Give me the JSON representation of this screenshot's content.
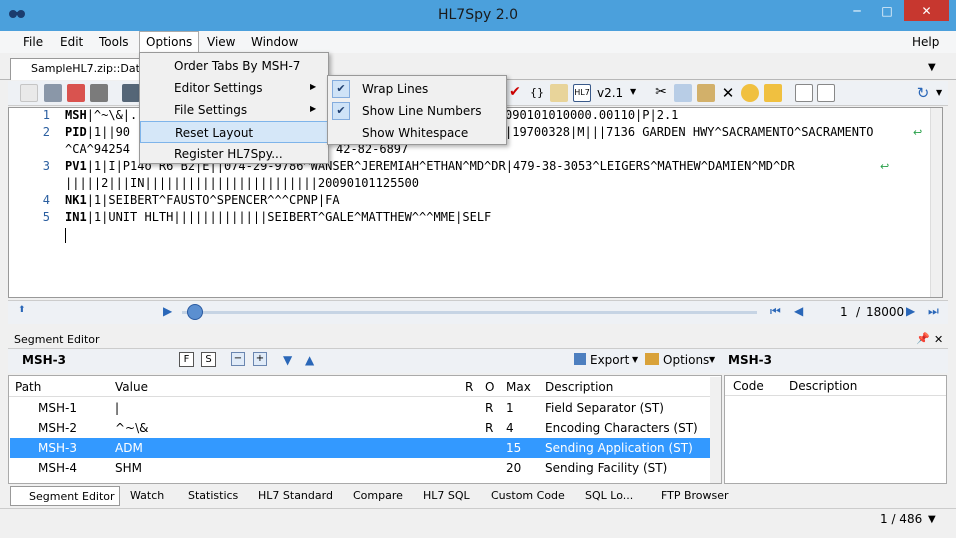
{
  "window": {
    "title": "HL7Spy 2.0",
    "minimize": "─",
    "maximize": "□",
    "close": "✕"
  },
  "menu": {
    "items": [
      "File",
      "Edit",
      "Tools",
      "Options",
      "View",
      "Window"
    ],
    "help": "Help"
  },
  "doc_tab": {
    "label": "SampleHL7.zip::Data."
  },
  "toolbar": {
    "version": "v2.1"
  },
  "options_menu": {
    "items": [
      "Order Tabs By MSH-7",
      "Editor Settings",
      "File Settings",
      "Reset Layout",
      "Register HL7Spy..."
    ]
  },
  "editor_settings_submenu": {
    "items": [
      {
        "label": "Wrap Lines",
        "checked": true
      },
      {
        "label": "Show Line Numbers",
        "checked": true
      },
      {
        "label": "Show Whitespace",
        "checked": false
      }
    ]
  },
  "editor": {
    "lines": [
      {
        "no": "1",
        "seg": "MSH",
        "text": "|^~\\&|.",
        "tail": "090101010000.00110|P|2.1"
      },
      {
        "no": "2",
        "seg": "PID",
        "text": "|1||90",
        "tail": "|19700328|M|||7136 GARDEN HWY^SACRAMENTO^SACRAMENTO"
      },
      {
        "no": "",
        "seg": "",
        "text": "^CA^94254",
        "tail": "42-82-6897"
      },
      {
        "no": "3",
        "seg": "PV1",
        "text": "|1|I|P14o R6 B2|E||074-29-9786^WANSER^JEREMIAH^ETHAN^MD^DR|479-38-3053^LEIGERS^MATHEW^DAMIEN^MD^DR",
        "tail": ""
      },
      {
        "no": "",
        "seg": "",
        "text": "|||||2|||IN||||||||||||||||||||||||20090101125500",
        "tail": ""
      },
      {
        "no": "4",
        "seg": "NK1",
        "text": "|1|SEIBERT^FAUSTO^SPENCER^^^CPNP|FA",
        "tail": ""
      },
      {
        "no": "5",
        "seg": "IN1",
        "text": "|1|UNIT HLTH|||||||||||||SEIBERT^GALE^MATTHEW^^^MME|SELF",
        "tail": ""
      }
    ]
  },
  "navigator": {
    "current": "1",
    "separator": "/",
    "total": "18000"
  },
  "segment_editor": {
    "panel_title": "Segment Editor",
    "segment_name": "MSH-3",
    "export_label": "Export",
    "options_label": "Options",
    "columns": [
      "Path",
      "Value",
      "R",
      "O",
      "Max",
      "Description"
    ],
    "rows": [
      {
        "path": "MSH-1",
        "value": "|",
        "r": "",
        "o": "R",
        "max": "1",
        "desc": "Field Separator (ST)"
      },
      {
        "path": "MSH-2",
        "value": "^~\\&",
        "r": "",
        "o": "R",
        "max": "4",
        "desc": "Encoding Characters (ST)"
      },
      {
        "path": "MSH-3",
        "value": "ADM",
        "r": "",
        "o": "",
        "max": "15",
        "desc": "Sending Application (ST)"
      },
      {
        "path": "MSH-4",
        "value": "SHM",
        "r": "",
        "o": "",
        "max": "20",
        "desc": "Sending Facility (ST)"
      }
    ],
    "side_title": "MSH-3",
    "side_columns": [
      "Code",
      "Description"
    ]
  },
  "bottom_tabs": [
    "Segment Editor",
    "Watch",
    "Statistics",
    "HL7 Standard",
    "Compare",
    "HL7 SQL",
    "Custom Code",
    "SQL Lo...",
    "FTP Browser"
  ],
  "status": {
    "position": "1 / 486"
  },
  "colors": {
    "titlebar": "#4ba0dc",
    "selection": "#3399ff",
    "accent": "#2b5fa0"
  }
}
